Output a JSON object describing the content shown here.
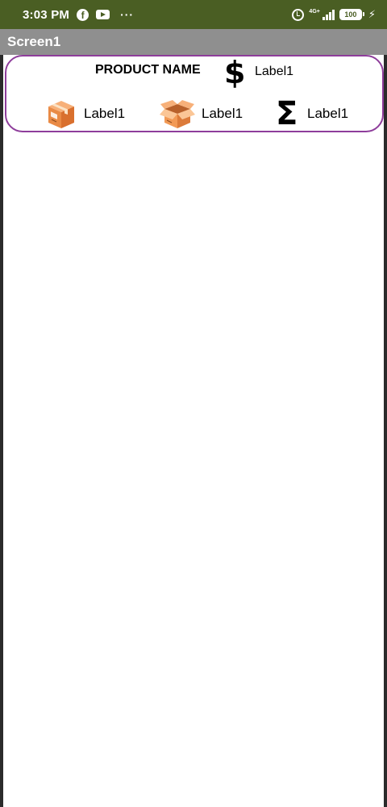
{
  "status_bar": {
    "time": "3:03 PM",
    "network": "4G+",
    "battery": "100",
    "more": "···",
    "bg_color": "#4a5e23"
  },
  "title_bar": {
    "title": "Screen1",
    "bg_color": "#8f8f8f"
  },
  "card": {
    "border_color": "#8e3d9b",
    "product_name": "PRODUCT NAME",
    "price_icon": "$",
    "price_label": "Label1",
    "items": [
      {
        "icon": "closed-box-icon",
        "label": "Label1"
      },
      {
        "icon": "open-box-icon",
        "label": "Label1"
      },
      {
        "icon": "sigma-icon",
        "symbol": "Σ",
        "label": "Label1"
      }
    ]
  }
}
